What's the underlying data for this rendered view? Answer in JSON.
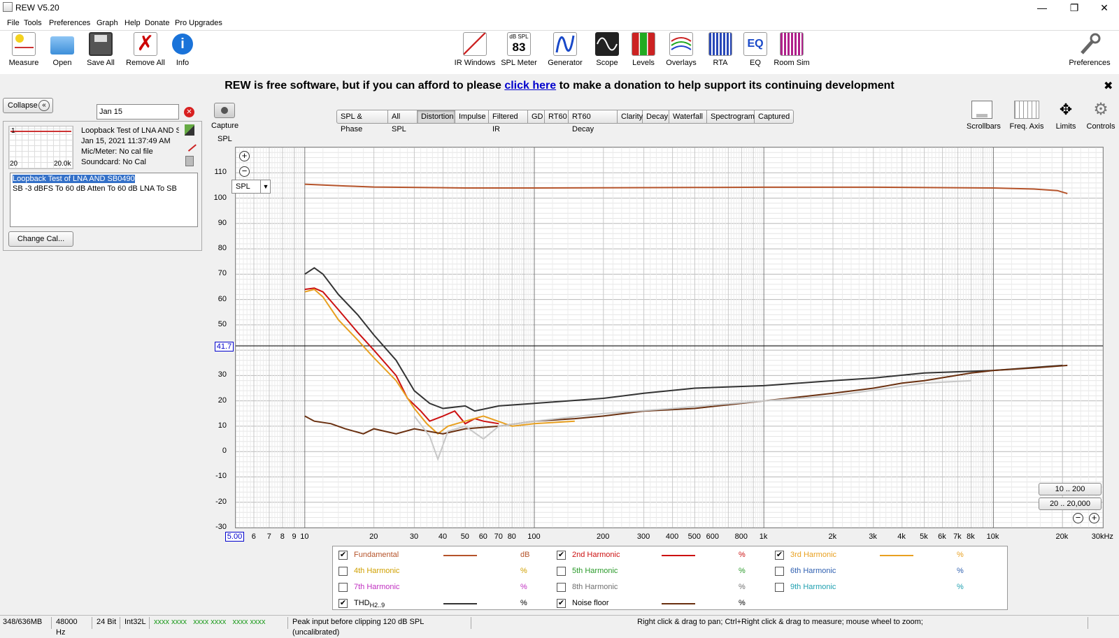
{
  "window": {
    "title": "REW V5.20"
  },
  "menu": [
    "File",
    "Tools",
    "Preferences",
    "Graph",
    "Help",
    "Donate",
    "Pro Upgrades"
  ],
  "toolbar_left": [
    "Measure",
    "Open",
    "Save All",
    "Remove All",
    "Info"
  ],
  "toolbar_mid": [
    "IR Windows",
    "SPL Meter",
    "Generator",
    "Scope",
    "Levels",
    "Overlays",
    "RTA",
    "EQ",
    "Room Sim"
  ],
  "spl_meter": {
    "unit": "dB SPL",
    "value": "83"
  },
  "toolbar_right": "Preferences",
  "banner": {
    "before": "REW is free software, but if you can afford to please ",
    "link": "click here",
    "after": " to make a donation to help support its continuing development"
  },
  "panel": {
    "collapse": "Collapse",
    "filter": "Jan 15",
    "thumb_min": "20",
    "thumb_max": "20.0k",
    "thumb_num": "1",
    "meas_name": "Loopback Test of LNA AND SB0490",
    "meas_date": "Jan 15, 2021 11:37:49 AM",
    "mic": "Mic/Meter: No cal file",
    "soundcard": "Soundcard: No Cal",
    "notes_title": "Loopback Test of LNA AND SB0490",
    "notes_body": "SB -3 dBFS To 60 dB Atten To 60 dB LNA To SB",
    "change_cal": "Change Cal..."
  },
  "capture": "Capture",
  "tabs": [
    "SPL & Phase",
    "All SPL",
    "Distortion",
    "Impulse",
    "Filtered IR",
    "GD",
    "RT60",
    "RT60 Decay",
    "Clarity",
    "Decay",
    "Waterfall",
    "Spectrogram",
    "Captured"
  ],
  "selected_tab": "Distortion",
  "graph_tools": [
    "Scrollbars",
    "Freq. Axis",
    "Limits",
    "Controls"
  ],
  "plot": {
    "y_title": "SPL",
    "y_select": "SPL",
    "cursor_value": "41.7",
    "x_start": "5.00",
    "range_buttons": [
      "10 .. 200",
      "20 .. 20,000"
    ]
  },
  "chart_data": {
    "type": "line",
    "y_axis_label": "SPL",
    "x_unit": "Hz",
    "log_x": true,
    "xlim": [
      5,
      30000
    ],
    "ylim": [
      -30,
      120
    ],
    "y_ticks": [
      "110",
      "100",
      "90",
      "80",
      "70",
      "60",
      "50",
      "40",
      "30",
      "20",
      "10",
      "0",
      "-10",
      "-20",
      "-30"
    ],
    "x_ticks": [
      {
        "v": 6,
        "t": "6"
      },
      {
        "v": 7,
        "t": "7"
      },
      {
        "v": 8,
        "t": "8"
      },
      {
        "v": 9,
        "t": "9"
      },
      {
        "v": 10,
        "t": "10"
      },
      {
        "v": 20,
        "t": "20"
      },
      {
        "v": 30,
        "t": "30"
      },
      {
        "v": 40,
        "t": "40"
      },
      {
        "v": 50,
        "t": "50"
      },
      {
        "v": 60,
        "t": "60"
      },
      {
        "v": 70,
        "t": "70"
      },
      {
        "v": 80,
        "t": "80"
      },
      {
        "v": 100,
        "t": "100"
      },
      {
        "v": 200,
        "t": "200"
      },
      {
        "v": 300,
        "t": "300"
      },
      {
        "v": 400,
        "t": "400"
      },
      {
        "v": 500,
        "t": "500"
      },
      {
        "v": 600,
        "t": "600"
      },
      {
        "v": 800,
        "t": "800"
      },
      {
        "v": 1000,
        "t": "1k"
      },
      {
        "v": 2000,
        "t": "2k"
      },
      {
        "v": 3000,
        "t": "3k"
      },
      {
        "v": 4000,
        "t": "4k"
      },
      {
        "v": 5000,
        "t": "5k"
      },
      {
        "v": 6000,
        "t": "6k"
      },
      {
        "v": 7000,
        "t": "7k"
      },
      {
        "v": 8000,
        "t": "8k"
      },
      {
        "v": 10000,
        "t": "10k"
      },
      {
        "v": 20000,
        "t": "20k"
      },
      {
        "v": 30000,
        "t": "30kHz"
      }
    ],
    "cursor_y": 41.7,
    "series": [
      {
        "name": "Fundamental",
        "color": "#b5532a",
        "unit": "dB",
        "checked": true,
        "show": true,
        "points": [
          [
            10,
            105.5
          ],
          [
            15,
            104.8
          ],
          [
            20,
            104.4
          ],
          [
            50,
            104
          ],
          [
            100,
            104
          ],
          [
            500,
            104.2
          ],
          [
            1000,
            104.3
          ],
          [
            3000,
            104.3
          ],
          [
            10000,
            104
          ],
          [
            15000,
            103.6
          ],
          [
            19000,
            103
          ],
          [
            21000,
            101.8
          ]
        ]
      },
      {
        "name": "2nd Harmonic",
        "color": "#cc1111",
        "unit": "%",
        "checked": true,
        "show": true,
        "points": [
          [
            10,
            64
          ],
          [
            11,
            64.5
          ],
          [
            12,
            63
          ],
          [
            14,
            56
          ],
          [
            17,
            47
          ],
          [
            20,
            40
          ],
          [
            25,
            30
          ],
          [
            28,
            21
          ],
          [
            32,
            16
          ],
          [
            35,
            12
          ],
          [
            40,
            14
          ],
          [
            45,
            16
          ],
          [
            50,
            11
          ],
          [
            55,
            13
          ],
          [
            60,
            12
          ],
          [
            70,
            11
          ]
        ]
      },
      {
        "name": "3rd Harmonic",
        "color": "#e8a020",
        "unit": "%",
        "checked": true,
        "show": true,
        "points": [
          [
            10,
            63
          ],
          [
            11,
            64
          ],
          [
            12,
            61
          ],
          [
            14,
            52
          ],
          [
            17,
            44
          ],
          [
            20,
            37
          ],
          [
            25,
            28
          ],
          [
            30,
            17
          ],
          [
            34,
            11
          ],
          [
            38,
            7
          ],
          [
            42,
            10
          ],
          [
            50,
            12
          ],
          [
            60,
            14
          ],
          [
            80,
            10
          ],
          [
            100,
            11
          ],
          [
            150,
            12
          ]
        ]
      },
      {
        "name": "4th Harmonic",
        "color": "#d0a000",
        "unit": "%",
        "checked": false,
        "show": false,
        "points": []
      },
      {
        "name": "5th Harmonic",
        "color": "#2a9a2a",
        "unit": "%",
        "checked": false,
        "show": false,
        "points": []
      },
      {
        "name": "6th Harmonic",
        "color": "#3060b0",
        "unit": "%",
        "checked": false,
        "show": false,
        "points": []
      },
      {
        "name": "7th Harmonic",
        "color": "#c030c0",
        "unit": "%",
        "checked": false,
        "show": false,
        "points": []
      },
      {
        "name": "8th Harmonic",
        "color": "#707070",
        "unit": "%",
        "checked": false,
        "show": false,
        "points": []
      },
      {
        "name": "9th Harmonic",
        "color": "#20a0b0",
        "unit": "%",
        "checked": false,
        "show": false,
        "points": []
      },
      {
        "name": "THD",
        "sub": "H2..9",
        "color": "#333333",
        "unit": "%",
        "checked": true,
        "show": true,
        "points": [
          [
            10,
            70
          ],
          [
            11,
            72.5
          ],
          [
            12,
            70
          ],
          [
            14,
            62
          ],
          [
            17,
            54
          ],
          [
            20,
            46
          ],
          [
            25,
            36
          ],
          [
            30,
            24
          ],
          [
            35,
            19
          ],
          [
            40,
            17
          ],
          [
            50,
            18
          ],
          [
            55,
            16
          ],
          [
            70,
            18
          ],
          [
            100,
            19
          ],
          [
            200,
            21
          ],
          [
            300,
            23
          ],
          [
            500,
            25
          ],
          [
            1000,
            26
          ],
          [
            2000,
            28
          ],
          [
            3000,
            29
          ],
          [
            5000,
            31
          ],
          [
            10000,
            32
          ],
          [
            20000,
            34
          ]
        ]
      },
      {
        "name": "Noise floor",
        "color": "#6a3010",
        "unit": "%",
        "checked": true,
        "show": true,
        "points": [
          [
            10,
            14
          ],
          [
            11,
            12
          ],
          [
            13,
            11
          ],
          [
            15,
            9
          ],
          [
            18,
            7
          ],
          [
            20,
            9
          ],
          [
            25,
            7
          ],
          [
            30,
            9
          ],
          [
            40,
            7
          ],
          [
            50,
            9
          ],
          [
            70,
            10
          ],
          [
            100,
            12
          ],
          [
            150,
            13
          ],
          [
            200,
            14
          ],
          [
            300,
            16
          ],
          [
            500,
            17
          ],
          [
            1000,
            20
          ],
          [
            2000,
            23
          ],
          [
            3000,
            25
          ],
          [
            4000,
            27
          ],
          [
            5000,
            28
          ],
          [
            8000,
            31
          ],
          [
            10000,
            32
          ],
          [
            15000,
            33
          ],
          [
            21000,
            34
          ]
        ]
      },
      {
        "name": "",
        "color": "#c8c8c8",
        "unit": "",
        "checked": false,
        "show": true,
        "points": [
          [
            30,
            14
          ],
          [
            35,
            6
          ],
          [
            38,
            -3
          ],
          [
            42,
            8
          ],
          [
            50,
            10
          ],
          [
            60,
            5
          ],
          [
            70,
            10
          ],
          [
            100,
            12
          ],
          [
            200,
            15
          ],
          [
            400,
            17
          ],
          [
            1000,
            20
          ],
          [
            2000,
            22
          ],
          [
            5000,
            27
          ],
          [
            8000,
            28
          ]
        ]
      }
    ]
  },
  "status": [
    "348/636MB",
    "48000 Hz",
    "24 Bit",
    "Int32L",
    "xxxx xxxx   xxxx xxxx   xxxx xxxx",
    "Peak input before clipping 120 dB SPL (uncalibrated)",
    "Right click & drag to pan; Ctrl+Right click & drag to measure; mouse wheel to zoom;"
  ]
}
